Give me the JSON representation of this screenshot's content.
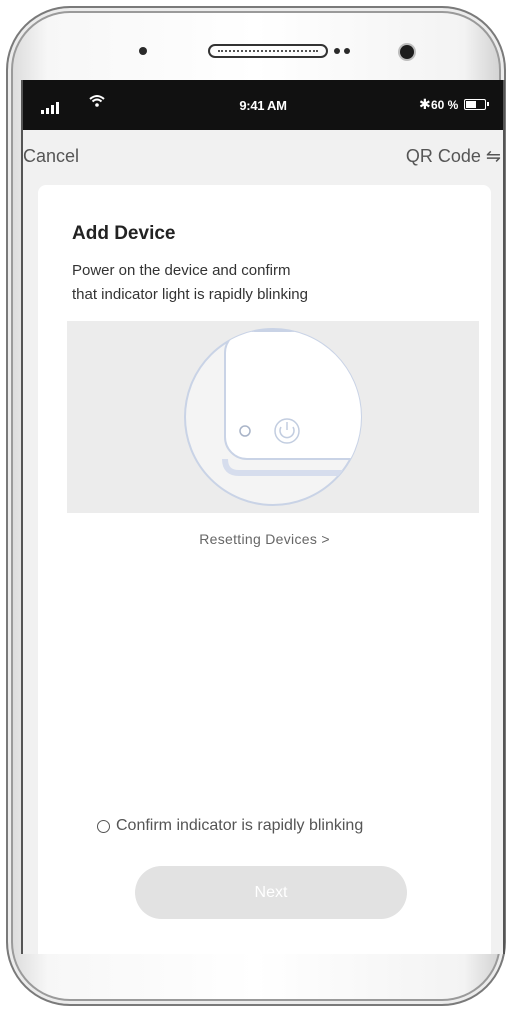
{
  "status_bar": {
    "time": "9:41 AM",
    "battery_text": "60 %",
    "battery_level": 0.6,
    "signal_icon": "signal-icon",
    "wifi_icon": "wifi-icon",
    "bluetooth_icon": "bluetooth-icon",
    "battery_icon": "battery-icon"
  },
  "nav": {
    "cancel_label": "Cancel",
    "qr_label": "QR Code",
    "qr_icon": "switch-arrows-icon"
  },
  "card": {
    "title": "Add Device",
    "description_line1": "Power on the device and confirm",
    "description_line2": "that indicator light is rapidly blinking",
    "illustration_icon": "device-power-illustration",
    "reset_link": "Resetting Devices >",
    "confirm_label": "Confirm indicator is rapidly blinking",
    "confirm_checked": false,
    "next_label": "Next"
  },
  "colors": {
    "status_bar_bg": "#111111",
    "screen_bg": "#f1f1f1",
    "card_bg": "#ffffff",
    "illustration_bg": "#ececec",
    "button_disabled_bg": "#e2e2e2"
  }
}
